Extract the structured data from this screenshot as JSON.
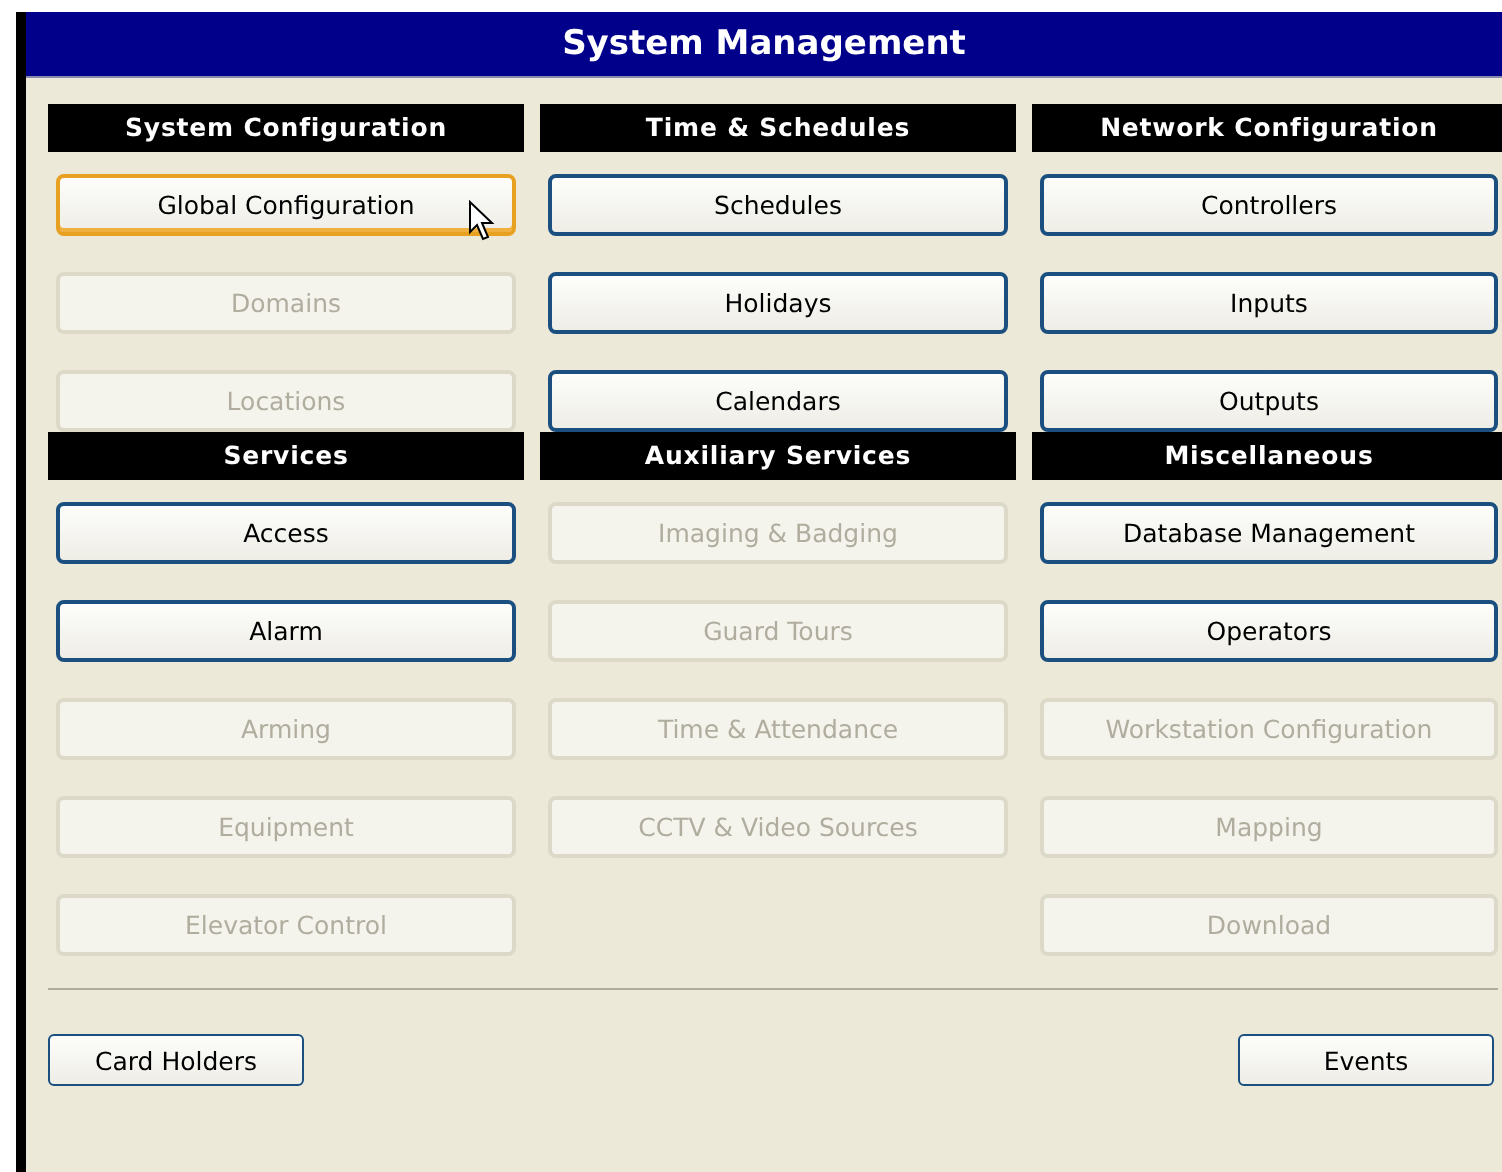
{
  "window": {
    "title": "System Management"
  },
  "groups": [
    {
      "sections": [
        {
          "title": "System Configuration",
          "buttons": [
            {
              "label": "Global Configuration",
              "disabled": false,
              "focused": true
            },
            {
              "label": "Domains",
              "disabled": true,
              "focused": false
            },
            {
              "label": "Locations",
              "disabled": true,
              "focused": false
            }
          ]
        },
        {
          "title": "Time & Schedules",
          "buttons": [
            {
              "label": "Schedules",
              "disabled": false,
              "focused": false
            },
            {
              "label": "Holidays",
              "disabled": false,
              "focused": false
            },
            {
              "label": "Calendars",
              "disabled": false,
              "focused": false
            }
          ]
        },
        {
          "title": "Network Configuration",
          "buttons": [
            {
              "label": "Controllers",
              "disabled": false,
              "focused": false
            },
            {
              "label": "Inputs",
              "disabled": false,
              "focused": false
            },
            {
              "label": "Outputs",
              "disabled": false,
              "focused": false
            }
          ]
        }
      ]
    },
    {
      "sections": [
        {
          "title": "Services",
          "buttons": [
            {
              "label": "Access",
              "disabled": false,
              "focused": false
            },
            {
              "label": "Alarm",
              "disabled": false,
              "focused": false
            },
            {
              "label": "Arming",
              "disabled": true,
              "focused": false
            },
            {
              "label": "Equipment",
              "disabled": true,
              "focused": false
            },
            {
              "label": "Elevator Control",
              "disabled": true,
              "focused": false
            }
          ]
        },
        {
          "title": "Auxiliary Services",
          "buttons": [
            {
              "label": "Imaging & Badging",
              "disabled": true,
              "focused": false
            },
            {
              "label": "Guard Tours",
              "disabled": true,
              "focused": false
            },
            {
              "label": "Time & Attendance",
              "disabled": true,
              "focused": false
            },
            {
              "label": "CCTV & Video Sources",
              "disabled": true,
              "focused": false
            }
          ]
        },
        {
          "title": "Miscellaneous",
          "buttons": [
            {
              "label": "Database Management",
              "disabled": false,
              "focused": false
            },
            {
              "label": "Operators",
              "disabled": false,
              "focused": false
            },
            {
              "label": "Workstation Configuration",
              "disabled": true,
              "focused": false
            },
            {
              "label": "Mapping",
              "disabled": true,
              "focused": false
            },
            {
              "label": "Download",
              "disabled": true,
              "focused": false
            }
          ]
        }
      ]
    }
  ],
  "footer_buttons": [
    {
      "label": "Card Holders"
    },
    {
      "label": "Events"
    }
  ]
}
